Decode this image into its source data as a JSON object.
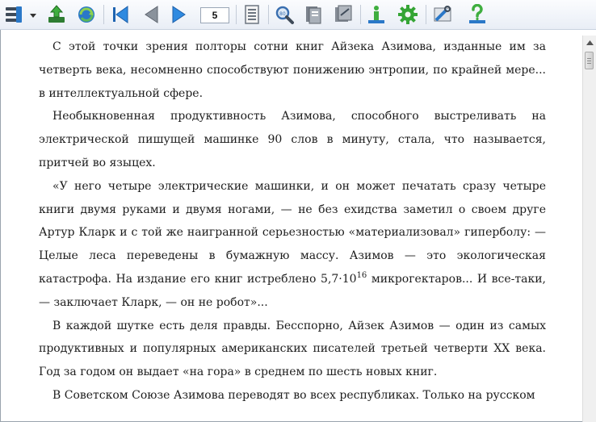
{
  "toolbar": {
    "page_number": "5",
    "icons": [
      "menu-icon",
      "dropdown-arrow-icon",
      "add-book-icon",
      "refresh-globe-icon",
      "first-page-icon",
      "previous-page-icon",
      "next-page-icon",
      "page-layout-icon",
      "zoom-icon",
      "contents-icon",
      "notes-icon",
      "info-icon",
      "settings-gear-icon",
      "tools-icon",
      "help-icon"
    ],
    "colors": {
      "green": "#2e9a2e",
      "blue": "#2a78c8",
      "gray": "#6d7580"
    }
  },
  "text": {
    "p1": "С этой точки зрения полторы сотни книг Айзека Азимова, изданные им за четверть века, несомненно способствуют понижению энтропии, по крайней мере... в интеллектуальной сфере.",
    "p2": "Необыкновенная продуктивность Азимова, способного выстреливать на электрической пишущей машинке 90 слов в минуту, стала, что называется, притчей во языцех.",
    "p3_a": "«У него четыре электрические машинки, и он может печатать сразу четыре книги двумя руками и двумя ногами, — не без ехидства заметил о своем друге Артур Кларк и с той же наигранной серьезностью «материализовал» гиперболу: — Целые леса переведены в бумажную массу. Азимов — это экологическая катастрофа. На издание его книг истреблено 5,7·10",
    "p3_sup": "16",
    "p3_b": " микрогектаров... И все-таки, — заключает Кларк, — он не робот»...",
    "p4": "В каждой шутке есть деля правды. Бесспорно, Айзек Азимов — один из самых продуктивных и популярных американских писателей третьей четверти XX века. Год за годом он выдает «на гора» в среднем по шесть новых книг.",
    "p5": "В Советском Союзе Азимова переводят во всех республиках. Только на русском"
  }
}
